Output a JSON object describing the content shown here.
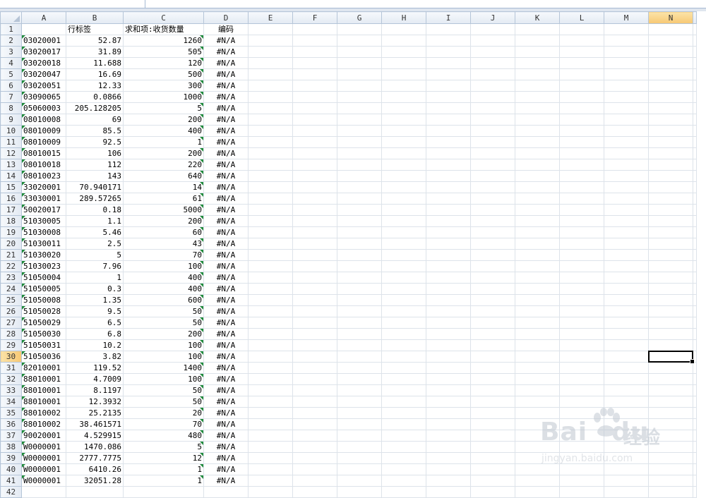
{
  "columns": [
    "A",
    "B",
    "C",
    "D",
    "E",
    "F",
    "G",
    "H",
    "I",
    "J",
    "K",
    "L",
    "M",
    "N"
  ],
  "selected_column": "N",
  "selected_row": 30,
  "header_row": {
    "row": 1,
    "A": "",
    "B": "行标签",
    "C": "求和项:收货数量",
    "D": "编码"
  },
  "rows": [
    {
      "row": 2,
      "A": "03020001",
      "B": "52.87",
      "C": "1260",
      "D": "#N/A"
    },
    {
      "row": 3,
      "A": "03020017",
      "B": "31.89",
      "C": "505",
      "D": "#N/A"
    },
    {
      "row": 4,
      "A": "03020018",
      "B": "11.688",
      "C": "120",
      "D": "#N/A"
    },
    {
      "row": 5,
      "A": "03020047",
      "B": "16.69",
      "C": "500",
      "D": "#N/A"
    },
    {
      "row": 6,
      "A": "03020051",
      "B": "12.33",
      "C": "300",
      "D": "#N/A"
    },
    {
      "row": 7,
      "A": "03090065",
      "B": "0.0866",
      "C": "1000",
      "D": "#N/A"
    },
    {
      "row": 8,
      "A": "05060003",
      "B": "205.128205",
      "C": "5",
      "D": "#N/A"
    },
    {
      "row": 9,
      "A": "08010008",
      "B": "69",
      "C": "200",
      "D": "#N/A"
    },
    {
      "row": 10,
      "A": "08010009",
      "B": "85.5",
      "C": "400",
      "D": "#N/A"
    },
    {
      "row": 11,
      "A": "08010009",
      "B": "92.5",
      "C": "1",
      "D": "#N/A"
    },
    {
      "row": 12,
      "A": "08010015",
      "B": "106",
      "C": "200",
      "D": "#N/A"
    },
    {
      "row": 13,
      "A": "08010018",
      "B": "112",
      "C": "220",
      "D": "#N/A"
    },
    {
      "row": 14,
      "A": "08010023",
      "B": "143",
      "C": "640",
      "D": "#N/A"
    },
    {
      "row": 15,
      "A": "33020001",
      "B": "70.940171",
      "C": "14",
      "D": "#N/A"
    },
    {
      "row": 16,
      "A": "33030001",
      "B": "289.57265",
      "C": "61",
      "D": "#N/A"
    },
    {
      "row": 17,
      "A": "50020017",
      "B": "0.18",
      "C": "5000",
      "D": "#N/A"
    },
    {
      "row": 18,
      "A": "51030005",
      "B": "1.1",
      "C": "200",
      "D": "#N/A"
    },
    {
      "row": 19,
      "A": "51030008",
      "B": "5.46",
      "C": "60",
      "D": "#N/A"
    },
    {
      "row": 20,
      "A": "51030011",
      "B": "2.5",
      "C": "43",
      "D": "#N/A"
    },
    {
      "row": 21,
      "A": "51030020",
      "B": "5",
      "C": "70",
      "D": "#N/A"
    },
    {
      "row": 22,
      "A": "51030023",
      "B": "7.96",
      "C": "100",
      "D": "#N/A"
    },
    {
      "row": 23,
      "A": "51050004",
      "B": "1",
      "C": "400",
      "D": "#N/A"
    },
    {
      "row": 24,
      "A": "51050005",
      "B": "0.3",
      "C": "400",
      "D": "#N/A"
    },
    {
      "row": 25,
      "A": "51050008",
      "B": "1.35",
      "C": "600",
      "D": "#N/A"
    },
    {
      "row": 26,
      "A": "51050028",
      "B": "9.5",
      "C": "50",
      "D": "#N/A"
    },
    {
      "row": 27,
      "A": "51050029",
      "B": "6.5",
      "C": "50",
      "D": "#N/A"
    },
    {
      "row": 28,
      "A": "51050030",
      "B": "6.8",
      "C": "200",
      "D": "#N/A"
    },
    {
      "row": 29,
      "A": "51050031",
      "B": "10.2",
      "C": "100",
      "D": "#N/A"
    },
    {
      "row": 30,
      "A": "51050036",
      "B": "3.82",
      "C": "100",
      "D": "#N/A"
    },
    {
      "row": 31,
      "A": "82010001",
      "B": "119.52",
      "C": "1400",
      "D": "#N/A"
    },
    {
      "row": 32,
      "A": "88010001",
      "B": "4.7009",
      "C": "100",
      "D": "#N/A"
    },
    {
      "row": 33,
      "A": "88010001",
      "B": "8.1197",
      "C": "50",
      "D": "#N/A"
    },
    {
      "row": 34,
      "A": "88010001",
      "B": "12.3932",
      "C": "50",
      "D": "#N/A"
    },
    {
      "row": 35,
      "A": "88010002",
      "B": "25.2135",
      "C": "20",
      "D": "#N/A"
    },
    {
      "row": 36,
      "A": "88010002",
      "B": "38.461571",
      "C": "70",
      "D": "#N/A"
    },
    {
      "row": 37,
      "A": "90020001",
      "B": "4.529915",
      "C": "480",
      "D": "#N/A"
    },
    {
      "row": 38,
      "A": "W0000001",
      "B": "1470.086",
      "C": "5",
      "D": "#N/A"
    },
    {
      "row": 39,
      "A": "W0000001",
      "B": "2777.7775",
      "C": "12",
      "D": "#N/A"
    },
    {
      "row": 40,
      "A": "W0000001",
      "B": "6410.26",
      "C": "1",
      "D": "#N/A"
    },
    {
      "row": 41,
      "A": "W0000001",
      "B": "32051.28",
      "C": "1",
      "D": "#N/A"
    }
  ],
  "trailing_row": 42,
  "watermark": {
    "brand": "Bai",
    "brand2": "du",
    "cn": "经验",
    "url": "jingyan.baidu.com"
  },
  "colors": {
    "grid": "#dde3ea",
    "header": "#e3eaf3",
    "selected_header": "#f7c873",
    "flag": "#1f8a3b"
  }
}
